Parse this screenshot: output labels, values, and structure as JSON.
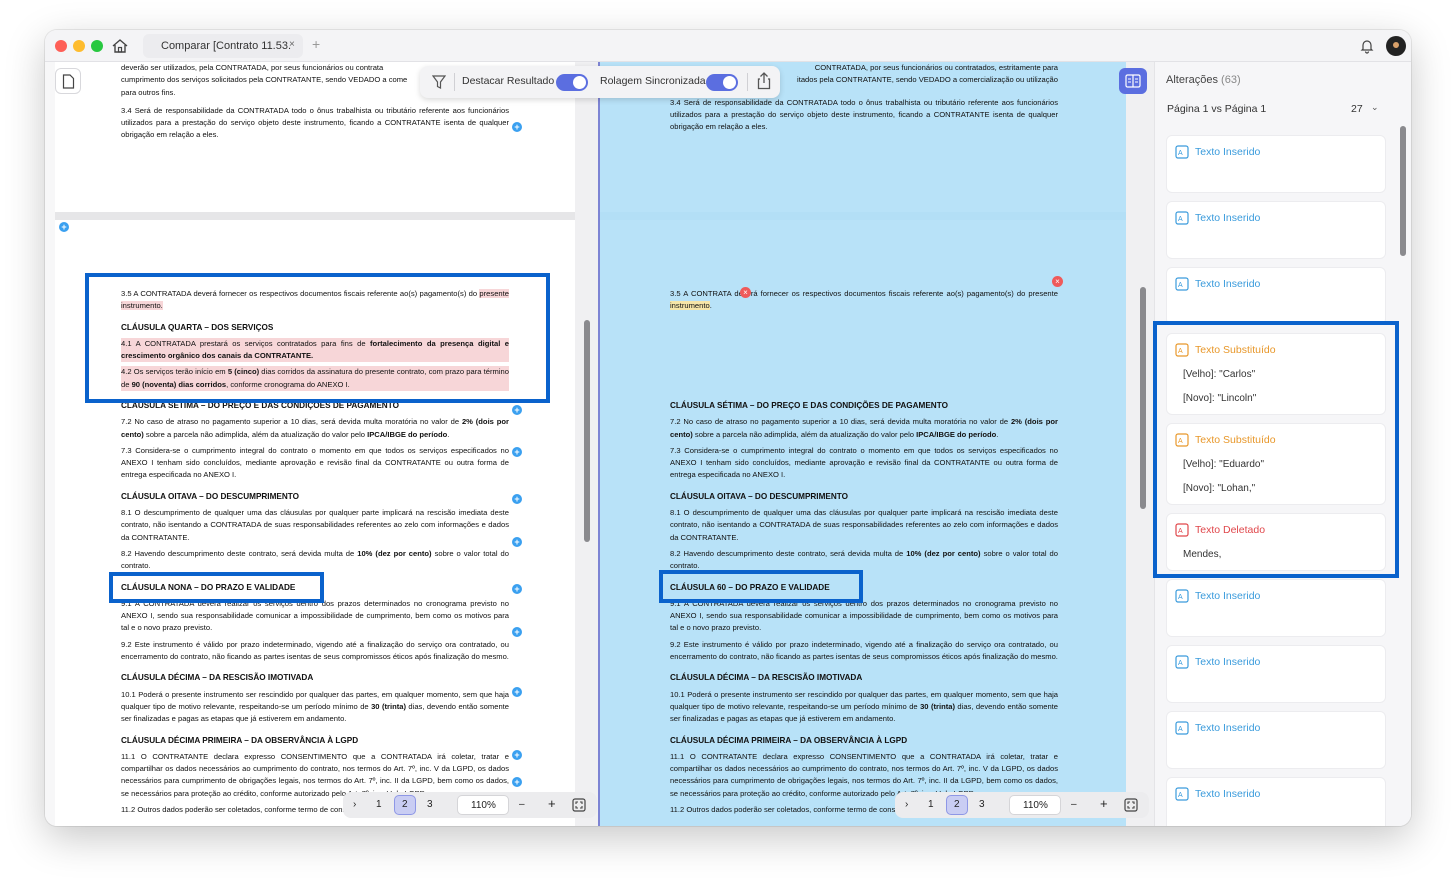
{
  "window": {
    "tab_title": "Comparar [Contrato 11.53.",
    "tab_close": "×",
    "tab_add": "+"
  },
  "toolbar": {
    "highlight_label": "Destacar Resultado",
    "sync_label": "Rolagem Sincronizada",
    "highlight_on": true,
    "sync_on": true
  },
  "left_doc": {
    "top_lines": [
      "deverão ser utilizados, pela CONTRATADA, por seus funcionários ou contrata",
      "cumprimento dos serviços solicitados pela CONTRATANTE, sendo VEDADO a come",
      "para outros fins."
    ],
    "p34": "3.4 Será de responsabilidade da CONTRATADA todo o ônus trabalhista ou tributário referente aos funcionários utilizados para a prestação do serviço objeto deste instrumento, ficando a CONTRATANTE isenta de qualquer obrigação em relação a eles.",
    "p35": "3.5 A CONTRATADA deverá fornecer os respectivos documentos fiscais referente ao(s) pagamento(s) do",
    "p35_hl": "presente instrumento.",
    "h4": "CLÁUSULA QUARTA – DOS SERVIÇOS",
    "p41_a": "4.1 A CONTRATADA prestará os serviços contratados para fins de ",
    "p41_b": "fortalecimento da presença digital e crescimento orgânico dos canais da CONTRATANTE.",
    "p42_a": "4.2 Os serviços terão início em ",
    "p42_b": "5 (cinco)",
    "p42_c": " dias corridos da assinatura do presente contrato, com prazo para término de ",
    "p42_d": "90 (noventa) dias corridos",
    "p42_e": ", conforme cronograma do ANEXO I.",
    "h7": "CLÁUSULA SÉTIMA – DO PREÇO E DAS CONDIÇÕES DE PAGAMENTO",
    "p72_a": "7.2 No caso de atraso no pagamento superior a 10 dias, será devida multa moratória no valor de ",
    "p72_b": "2% (dois por cento)",
    "p72_c": " sobre a parcela não adimplida, além da atualização do valor pelo ",
    "p72_d": "IPCA/IBGE do período",
    "p72_e": ".",
    "p73": "7.3 Considera-se o cumprimento integral do contrato o momento em que todos os serviços especificados no ANEXO I tenham sido concluídos, mediante aprovação e revisão final da CONTRATANTE ou outra forma de entrega especificada no ANEXO I.",
    "h8": "CLÁUSULA OITAVA – DO DESCUMPRIMENTO",
    "p81": "8.1 O descumprimento de qualquer uma das cláusulas por qualquer parte implicará na rescisão imediata deste contrato, não isentando a CONTRATADA de suas responsabilidades referentes ao zelo com informações e dados da CONTRATANTE.",
    "p82_a": "8.2 Havendo descumprimento deste contrato, será devida multa de ",
    "p82_b": "10% (dez por cento)",
    "p82_c": " sobre o valor total do contrato.",
    "h9": "CLÁUSULA NONA – DO PRAZO E VALIDADE",
    "p91": "9.1 A CONTRATADA deverá realizar os serviços dentro dos prazos determinados no cronograma previsto no ANEXO I, sendo sua responsabilidade comunicar a impossibilidade de cumprimento, bem como os motivos para tal e o novo prazo previsto.",
    "p92": "9.2 Este instrumento é válido por prazo indeterminado, vigendo até a finalização do serviço ora contratado, ou encerramento do contrato, não ficando as partes isentas de seus compromissos éticos após finalização do mesmo.",
    "h10": "CLÁUSULA DÉCIMA – DA RESCISÃO IMOTIVADA",
    "p101_a": "10.1 Poderá o presente instrumento ser rescindido por qualquer das partes, em qualquer momento, sem que haja qualquer tipo de motivo relevante, respeitando-se um período mínimo de ",
    "p101_b": "30 (trinta)",
    "p101_c": " dias, devendo então somente ser finalizadas e pagas as etapas que já estiverem em andamento.",
    "h11": "CLÁUSULA DÉCIMA PRIMEIRA – DA OBSERVÂNCIA À LGPD",
    "p111": "11.1 O CONTRATANTE declara expresso CONSENTIMENTO que a CONTRATADA irá coletar, tratar e compartilhar os dados necessários ao cumprimento do contrato, nos termos do Art. 7º, inc. V da LGPD, os dados necessários para cumprimento de obrigações legais, nos termos do Art. 7º, inc. II da LGPD, bem como os dados, se necessários para proteção ao crédito, conforme autorizado pelo Art. 7º, inc. V da LGPD.",
    "p112": "11.2 Outros dados poderão ser coletados, conforme termo de consentimento específico."
  },
  "right_doc": {
    "top_lines": [
      "CONTRATADA, por seus funcionários ou contratados, estritamente para",
      "itados pela CONTRATANTE, sendo VEDADO a comercialização ou utilização"
    ],
    "p34": "3.4 Será de responsabilidade da CONTRATADA todo o ônus trabalhista ou tributário referente aos funcionários utilizados para a prestação do serviço objeto deste instrumento, ficando a CONTRATANTE isenta de qualquer obrigação em relação a eles.",
    "p35_a": "3.5 A CONTRATA",
    "p35_b": " deverá fornecer os respectivos documentos fiscais referente ao(s) pagamento(s) do presente ",
    "p35_c": "instrumento",
    "p35_d": ".",
    "h7": "CLÁUSULA SÉTIMA – DO PREÇO E DAS CONDIÇÕES DE PAGAMENTO",
    "h8": "CLÁUSULA OITAVA – DO DESCUMPRIMENTO",
    "h9": "CLÁUSULA 60 – DO PRAZO E VALIDADE",
    "h10": "CLÁUSULA DÉCIMA – DA RESCISÃO IMOTIVADA",
    "h11": "CLÁUSULA DÉCIMA PRIMEIRA – DA OBSERVÂNCIA À LGPD"
  },
  "pager_left": {
    "prev": "›",
    "pages": [
      "1",
      "2",
      "3"
    ],
    "active": "2",
    "zoom": "110%",
    "minus": "–",
    "plus": "+"
  },
  "pager_right": {
    "prev": "›",
    "pages": [
      "1",
      "2",
      "3"
    ],
    "active": "2",
    "zoom": "110%",
    "minus": "–",
    "plus": "+"
  },
  "sidebar": {
    "title": "Alterações",
    "count": "(63)",
    "pages_label": "Página 1 vs Página 1",
    "page_num": "27",
    "chev": "⌄",
    "cards": [
      {
        "type": "ins",
        "title": "Texto Inserido"
      },
      {
        "type": "ins",
        "title": "Texto Inserido"
      },
      {
        "type": "ins",
        "title": "Texto Inserido"
      },
      {
        "type": "sub",
        "title": "Texto Substituído",
        "old": "[Velho]: \"Carlos\"",
        "new": "[Novo]: \"Lincoln\""
      },
      {
        "type": "sub",
        "title": "Texto Substituído",
        "old": "[Velho]: \"Eduardo\"",
        "new": "[Novo]: \"Lohan,\""
      },
      {
        "type": "del",
        "title": "Texto Deletado",
        "old": "Mendes,"
      },
      {
        "type": "ins",
        "title": "Texto Inserido"
      },
      {
        "type": "ins",
        "title": "Texto Inserido"
      },
      {
        "type": "ins",
        "title": "Texto Inserido"
      },
      {
        "type": "ins",
        "title": "Texto Inserido"
      }
    ]
  },
  "colors": {
    "accent": "#5b6ee0",
    "annotation": "#0a62cc",
    "inserted": "#3a9bdc",
    "substituted": "#e8982b",
    "deleted": "#e0474b",
    "right_pane_bg": "#b8e2f8"
  }
}
